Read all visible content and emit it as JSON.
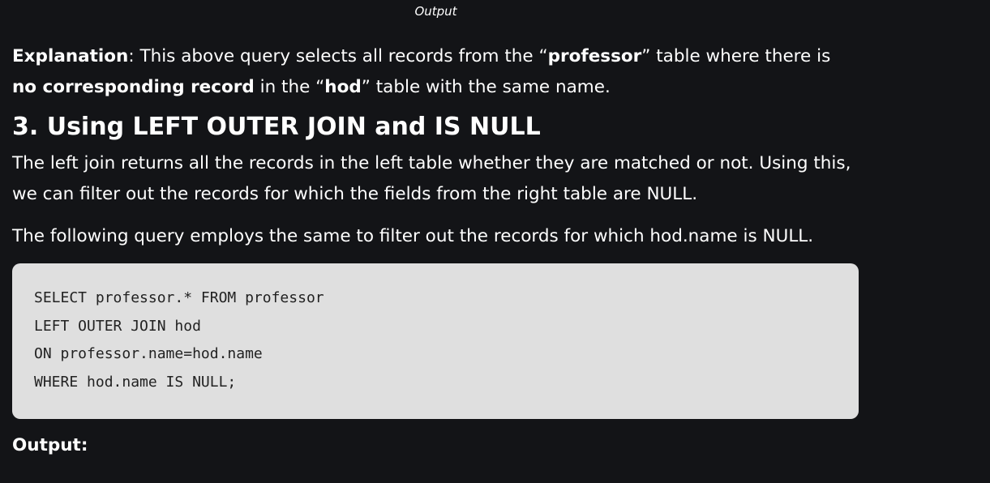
{
  "caption": "Output",
  "explanation": {
    "label": "Explanation",
    "text_1": ": This above query selects all records from the “",
    "bold_1": "professor",
    "text_2": "” table where there is ",
    "bold_2": "no corresponding record",
    "text_3": " in the “",
    "bold_3": "hod",
    "text_4": "” table with the same name."
  },
  "section": {
    "heading": "3. Using LEFT OUTER JOIN and IS NULL",
    "paragraph_1": "The left join returns all the records in the left table whether they are matched or not. Using this, we can filter out the records for which the fields from the right table are NULL.",
    "paragraph_2": "The following query employs the same to filter out the records for which hod.name is NULL."
  },
  "code": {
    "lines": [
      "SELECT professor.* FROM professor",
      "LEFT OUTER JOIN hod",
      "ON professor.name=hod.name",
      "WHERE hod.name IS NULL;"
    ]
  },
  "output": {
    "label": "Output",
    "colon": ":"
  }
}
